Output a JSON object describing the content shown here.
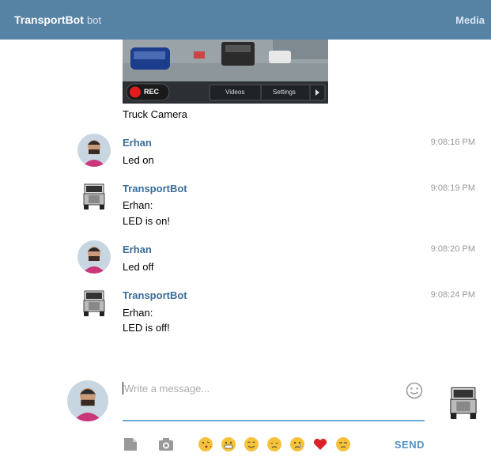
{
  "header": {
    "title": "TransportBot",
    "subtitle": "bot",
    "media_label": "Media"
  },
  "camera": {
    "rec_label": "REC",
    "videos_label": "Videos",
    "settings_label": "Settings",
    "caption": "Truck Camera"
  },
  "messages": [
    {
      "sender": "Erhan",
      "time": "9:08:16 PM",
      "lines": [
        "Led on"
      ],
      "avatar": "user-photo"
    },
    {
      "sender": "TransportBot",
      "time": "9:08:19 PM",
      "lines": [
        "Erhan:",
        "LED is on!"
      ],
      "avatar": "truck-icon"
    },
    {
      "sender": "Erhan",
      "time": "9:08:20 PM",
      "lines": [
        "Led off"
      ],
      "avatar": "user-photo"
    },
    {
      "sender": "TransportBot",
      "time": "9:08:24 PM",
      "lines": [
        "Erhan:",
        "LED is off!"
      ],
      "avatar": "truck-icon"
    }
  ],
  "compose": {
    "placeholder": "Write a message...",
    "send_label": "SEND"
  },
  "icons": [
    "document-icon",
    "camera-icon",
    "smile-icon"
  ],
  "emojis": [
    "kiss-emoji",
    "grin-emoji",
    "smile-emoji",
    "pensive-emoji",
    "cry-emoji",
    "heart-emoji",
    "unamused-emoji"
  ],
  "colors": {
    "header": "#5682a3",
    "sender": "#3a6d99",
    "accent": "#4f92c6"
  }
}
